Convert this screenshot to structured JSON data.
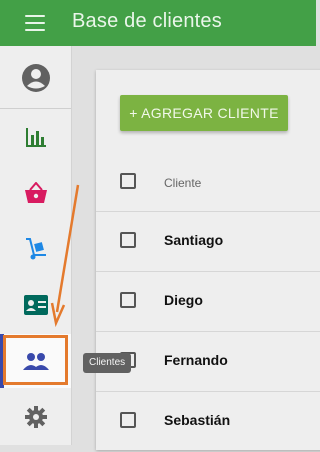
{
  "header": {
    "title": "Base de clientes",
    "menu_icon": "menu-icon"
  },
  "sidebar": {
    "items": [
      {
        "name": "account",
        "icon": "account-icon",
        "color": "#616161"
      },
      {
        "name": "reports",
        "icon": "bar-chart-icon",
        "color": "#2e7d32"
      },
      {
        "name": "sales",
        "icon": "basket-icon",
        "color": "#d81b60"
      },
      {
        "name": "delivery",
        "icon": "hand-truck-icon",
        "color": "#1e88e5"
      },
      {
        "name": "employees",
        "icon": "id-card-icon",
        "color": "#00695c"
      },
      {
        "name": "clients",
        "icon": "people-icon",
        "color": "#3949ab",
        "active": true
      },
      {
        "name": "settings",
        "icon": "gear-icon",
        "color": "#616161"
      }
    ]
  },
  "tooltip": {
    "text": "Clientes"
  },
  "main": {
    "add_button_label": "+ AGREGAR CLIENTE",
    "table": {
      "header": "Cliente",
      "rows": [
        "Santiago",
        "Diego",
        "Fernando",
        "Sebastián"
      ]
    }
  },
  "colors": {
    "primary": "#43a047",
    "accent": "#7cb342",
    "highlight": "#e47a2d"
  }
}
